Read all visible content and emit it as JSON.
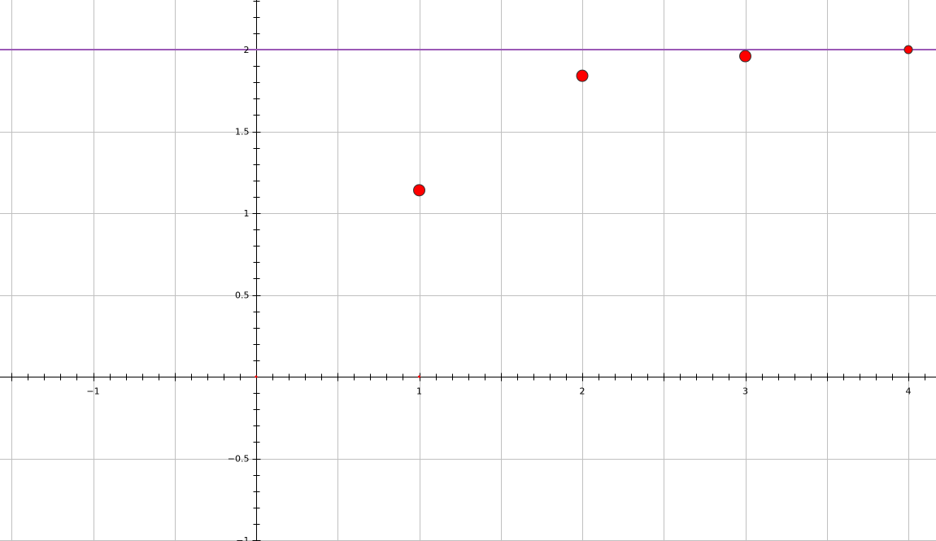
{
  "chart_data": {
    "type": "scatter",
    "title": "",
    "xlabel": "",
    "ylabel": "",
    "xlim": [
      -1.5,
      4.16
    ],
    "ylim": [
      -1.0,
      2.3
    ],
    "grid": true,
    "x_ticks": [
      {
        "value": -1,
        "label": "−1"
      },
      {
        "value": 1,
        "label": "1"
      },
      {
        "value": 2,
        "label": "2"
      },
      {
        "value": 3,
        "label": "3"
      },
      {
        "value": 4,
        "label": "4"
      }
    ],
    "y_ticks": [
      {
        "value": 2,
        "label": "2"
      },
      {
        "value": 1.5,
        "label": "1.5"
      },
      {
        "value": 1,
        "label": "1"
      },
      {
        "value": 0.5,
        "label": "0.5"
      },
      {
        "value": -0.5,
        "label": "−0.5"
      },
      {
        "value": -1,
        "label": "−1"
      }
    ],
    "series": [
      {
        "points": [
          {
            "x": 1,
            "y": 1.14
          },
          {
            "x": 2,
            "y": 1.84
          },
          {
            "x": 3,
            "y": 1.96
          },
          {
            "x": 4,
            "y": 2.0,
            "small": true
          }
        ],
        "color": "#ff0000"
      }
    ],
    "lines": [
      {
        "y": 2,
        "color": "#9b59b6"
      }
    ],
    "colors": {
      "grid": "#c0c0c0",
      "axis": "#000000",
      "origin_marker": "#ff0000"
    }
  }
}
